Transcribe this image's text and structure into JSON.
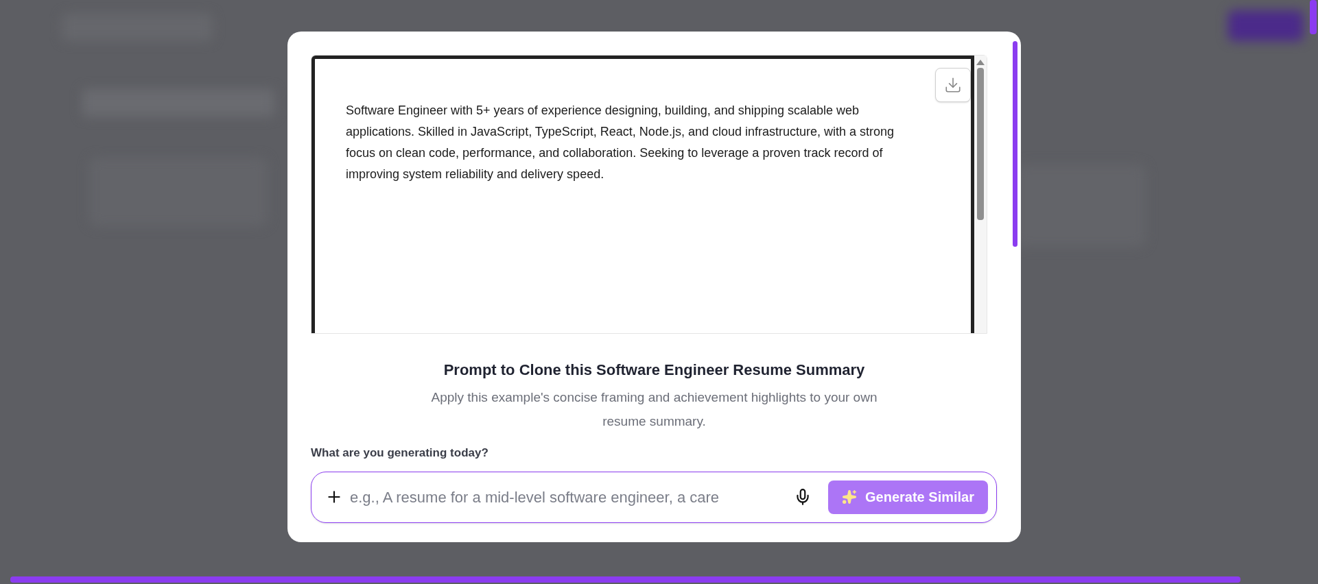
{
  "document": {
    "summary": "Software Engineer with 5+ years of experience designing, building, and shipping scalable web applications. Skilled in JavaScript, TypeScript, React, Node.js, and cloud infrastructure, with a strong focus on clean code, performance, and collaboration. Seeking to leverage a proven track record of improving system reliability and delivery speed."
  },
  "prompt": {
    "title": "Prompt to Clone this Software Engineer Resume Summary",
    "description": "Apply this example's concise framing and achievement highlights to your own resume summary.",
    "label": "What are you generating today?",
    "placeholder": "e.g., A resume for a mid-level software engineer, a care",
    "button": "Generate Similar"
  }
}
